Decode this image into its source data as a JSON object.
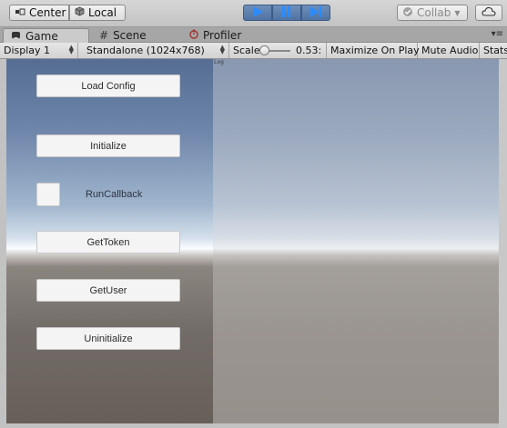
{
  "toolbar": {
    "pivot_label": "Center",
    "space_label": "Local",
    "collab_label": "Collab",
    "colors": {
      "play_active": "#4f73a3",
      "play_icon": "#2f6fd6"
    }
  },
  "tabs": [
    {
      "label": "Game",
      "icon": "game-icon",
      "active": true
    },
    {
      "label": "Scene",
      "icon": "scene-grid-icon",
      "active": false
    },
    {
      "label": "Profiler",
      "icon": "profiler-icon",
      "active": false
    }
  ],
  "gamebar": {
    "display": "Display 1",
    "resolution": "Standalone (1024x768)",
    "scale_label": "Scale",
    "scale_value": "0.53:",
    "maximize": "Maximize On Play",
    "mute": "Mute Audio",
    "stats": "Stats"
  },
  "game": {
    "log_label": "Log",
    "buttons": {
      "load_config": "Load Config",
      "initialize": "Initialize",
      "run_callback": "RunCallback",
      "get_token": "GetToken",
      "get_user": "GetUser",
      "uninitialize": "Uninitialize"
    }
  }
}
